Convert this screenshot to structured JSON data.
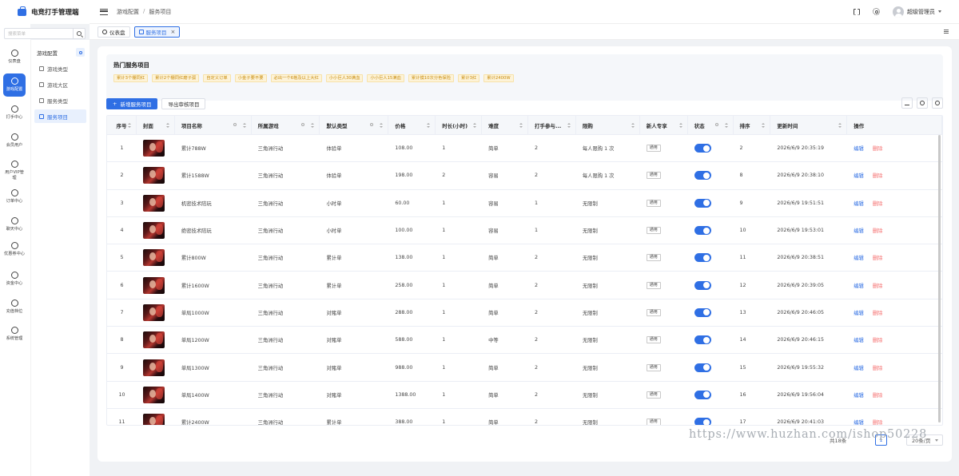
{
  "app": {
    "title": "电竞打手管理端"
  },
  "header": {
    "breadcrumb": [
      "游戏配置",
      "服务项目"
    ],
    "user_name": "超级管理员"
  },
  "sidebar": {
    "search_placeholder": "搜索菜单",
    "items": [
      {
        "label": "仪表盘",
        "icon": "dashboard-icon"
      },
      {
        "label": "游戏配置",
        "icon": "rocket-icon"
      },
      {
        "label": "打手中心",
        "icon": "lightning-icon"
      },
      {
        "label": "会员用户",
        "icon": "users-icon"
      },
      {
        "label": "用户VIP管理",
        "icon": "crown-icon"
      },
      {
        "label": "订单中心",
        "icon": "cart-icon"
      },
      {
        "label": "聊天中心",
        "icon": "chat-icon"
      },
      {
        "label": "优惠券中心",
        "icon": "gift-icon"
      },
      {
        "label": "资金中心",
        "icon": "wallet-icon"
      },
      {
        "label": "充值档位",
        "icon": "yen-icon"
      },
      {
        "label": "系统管理",
        "icon": "gear-icon"
      }
    ],
    "active_index": 1
  },
  "submenu": {
    "title": "游戏配置",
    "items": [
      {
        "label": "游戏类型",
        "icon": "grid-icon"
      },
      {
        "label": "游戏大区",
        "icon": "location-icon"
      },
      {
        "label": "服务类型",
        "icon": "tag-icon"
      },
      {
        "label": "服务项目",
        "icon": "list-icon"
      }
    ],
    "active_index": 3
  },
  "tabs": [
    {
      "label": "仪表盘",
      "active": false
    },
    {
      "label": "服务项目",
      "active": true,
      "close": "×"
    }
  ],
  "hot": {
    "title": "热门服务项目",
    "tags": [
      "累计3个棚同红",
      "累计2个棚同红磨子弧",
      "自定义订单",
      "小金子要不要",
      "必出一个6格及以上大红",
      "小小巨人30满血",
      "小小巨人15满血",
      "累计摸10次分色保险",
      "累计3红",
      "累计2400W"
    ]
  },
  "toolbar": {
    "add_label": "新增服务项目",
    "export_label": "导出审核项目"
  },
  "table": {
    "columns": [
      "序号",
      "封面",
      "项目名称",
      "所属游戏",
      "默认类型",
      "价格",
      "时长(小时)",
      "难度",
      "打手参与...",
      "限购",
      "新人专享",
      "状态",
      "排序",
      "更新时间",
      "操作"
    ],
    "edit_label": "编辑",
    "delete_label": "删除",
    "rows": [
      {
        "idx": "1",
        "name": "累计788W",
        "game": "三角洲行动",
        "type": "体验单",
        "price": "108.00",
        "hours": "1",
        "difficulty": "简单",
        "players": "2",
        "limit": "每人限购 1 次",
        "newbie": "通用",
        "enabled": true,
        "sort": "2",
        "updated": "2026/6/9 20:35:19"
      },
      {
        "idx": "2",
        "name": "累计1588W",
        "game": "三角洲行动",
        "type": "体验单",
        "price": "198.00",
        "hours": "2",
        "difficulty": "容易",
        "players": "2",
        "limit": "每人限购 1 次",
        "newbie": "通用",
        "enabled": true,
        "sort": "8",
        "updated": "2026/6/9 20:38:10"
      },
      {
        "idx": "3",
        "name": "机密技术陪玩",
        "game": "三角洲行动",
        "type": "小时单",
        "price": "60.00",
        "hours": "1",
        "difficulty": "容易",
        "players": "1",
        "limit": "无限制",
        "newbie": "通用",
        "enabled": true,
        "sort": "9",
        "updated": "2026/6/9 19:51:51"
      },
      {
        "idx": "4",
        "name": "绝密技术陪玩",
        "game": "三角洲行动",
        "type": "小时单",
        "price": "100.00",
        "hours": "1",
        "difficulty": "容易",
        "players": "1",
        "limit": "无限制",
        "newbie": "通用",
        "enabled": true,
        "sort": "10",
        "updated": "2026/6/9 19:53:01"
      },
      {
        "idx": "5",
        "name": "累计800W",
        "game": "三角洲行动",
        "type": "累计单",
        "price": "138.00",
        "hours": "1",
        "difficulty": "简单",
        "players": "2",
        "limit": "无限制",
        "newbie": "通用",
        "enabled": true,
        "sort": "11",
        "updated": "2026/6/9 20:38:51"
      },
      {
        "idx": "6",
        "name": "累计1600W",
        "game": "三角洲行动",
        "type": "累计单",
        "price": "258.00",
        "hours": "1",
        "difficulty": "简单",
        "players": "2",
        "limit": "无限制",
        "newbie": "通用",
        "enabled": true,
        "sort": "12",
        "updated": "2026/6/9 20:39:05"
      },
      {
        "idx": "7",
        "name": "单局1000W",
        "game": "三角洲行动",
        "type": "对赌单",
        "price": "288.00",
        "hours": "1",
        "difficulty": "简单",
        "players": "2",
        "limit": "无限制",
        "newbie": "通用",
        "enabled": true,
        "sort": "13",
        "updated": "2026/6/9 20:46:05"
      },
      {
        "idx": "8",
        "name": "单局1200W",
        "game": "三角洲行动",
        "type": "对赌单",
        "price": "588.00",
        "hours": "1",
        "difficulty": "中等",
        "players": "2",
        "limit": "无限制",
        "newbie": "通用",
        "enabled": true,
        "sort": "14",
        "updated": "2026/6/9 20:46:15"
      },
      {
        "idx": "9",
        "name": "单局1300W",
        "game": "三角洲行动",
        "type": "对赌单",
        "price": "988.00",
        "hours": "1",
        "difficulty": "简单",
        "players": "2",
        "limit": "无限制",
        "newbie": "通用",
        "enabled": true,
        "sort": "15",
        "updated": "2026/6/9 19:55:32"
      },
      {
        "idx": "10",
        "name": "单局1400W",
        "game": "三角洲行动",
        "type": "对赌单",
        "price": "1388.00",
        "hours": "1",
        "difficulty": "简单",
        "players": "2",
        "limit": "无限制",
        "newbie": "通用",
        "enabled": true,
        "sort": "16",
        "updated": "2026/6/9 19:56:04"
      },
      {
        "idx": "11",
        "name": "累计2400W",
        "game": "三角洲行动",
        "type": "累计单",
        "price": "388.00",
        "hours": "1",
        "difficulty": "简单",
        "players": "2",
        "limit": "无限制",
        "newbie": "通用",
        "enabled": true,
        "sort": "17",
        "updated": "2026/6/9 20:41:03"
      }
    ]
  },
  "pagination": {
    "total_label": "共18条",
    "current_page": "1",
    "page_size": "20条/页"
  },
  "watermark": "https://www.huzhan.com/ishop50228",
  "colors": {
    "accent": "#2f6fe4",
    "danger": "#f56c6c",
    "tag_bg": "#fdf3d8",
    "tag_text": "#c98d10"
  }
}
